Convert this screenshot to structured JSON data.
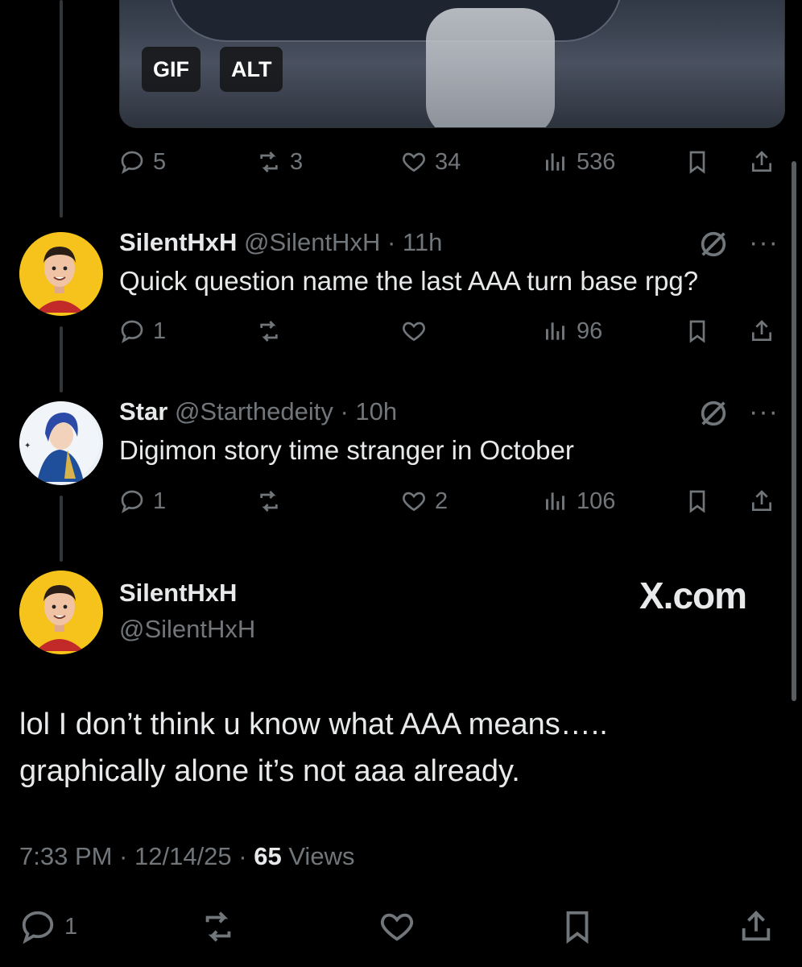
{
  "media": {
    "gif_label": "GIF",
    "alt_label": "ALT"
  },
  "media_actions": {
    "replies": "5",
    "reposts": "3",
    "likes": "34",
    "views": "536"
  },
  "reply1": {
    "name": "SilentHxH",
    "handle": "@SilentHxH",
    "time": "· 11h",
    "text": "Quick question name the last AAA turn base rpg?",
    "replies": "1",
    "reposts": "",
    "likes": "",
    "views": "96"
  },
  "reply2": {
    "name": "Star",
    "handle": "@Starthedeity",
    "time": "· 10h",
    "text": "Digimon story time stranger in October",
    "replies": "1",
    "reposts": "",
    "likes": "2",
    "views": "106"
  },
  "main": {
    "name": "SilentHxH",
    "handle": "@SilentHxH",
    "watermark": "X.com",
    "text_line1": "lol I don’t think u know what AAA means…..",
    "text_line2": "graphically alone it’s not aaa already.",
    "time": "7:33 PM · 12/14/25 · ",
    "views_count": "65",
    "views_label": " Views",
    "replies": "1"
  },
  "colors": {
    "background": "#000000",
    "text": "#e7e9ea",
    "muted": "#71767b",
    "line": "#333639"
  },
  "icons": [
    "reply-icon",
    "repost-icon",
    "like-icon",
    "views-icon",
    "bookmark-icon",
    "share-icon",
    "grok-icon",
    "more-icon"
  ]
}
